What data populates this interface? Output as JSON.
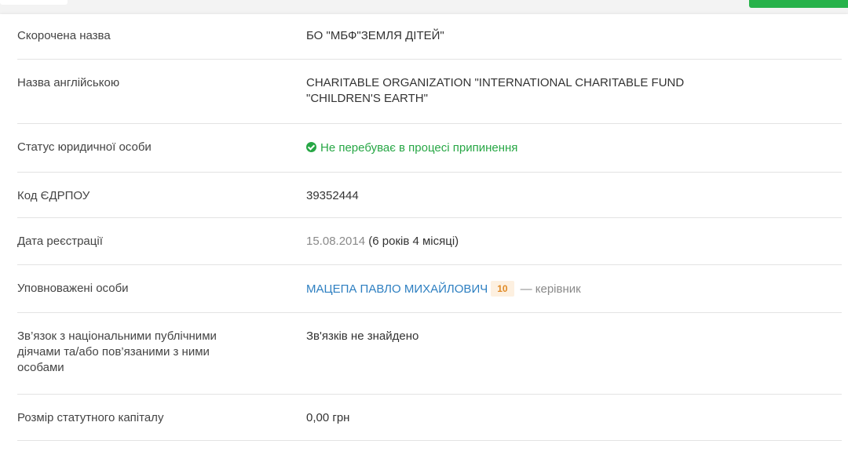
{
  "rows": [
    {
      "label": "Скорочена назва",
      "value": "БО \"МБФ\"ЗЕМЛЯ ДІТЕЙ\""
    },
    {
      "label": "Назва англійською",
      "value_line1": "CHARITABLE ORGANIZATION \"INTERNATIONAL CHARITABLE FUND",
      "value_line2": "\"CHILDREN'S EARTH\""
    },
    {
      "label": "Статус юридичної особи",
      "value": "Не перебуває в процесі припинення",
      "status_color": "#27a745"
    },
    {
      "label": "Код ЄДРПОУ",
      "value": "39352444"
    },
    {
      "label": "Дата реєстрації",
      "date": "15.08.2014",
      "duration": "(6 років 4 місяці)"
    },
    {
      "label": "Уповноважені особи",
      "person": "МАЦЕПА ПАВЛО МИХАЙЛОВИЧ",
      "badge": "10",
      "role": "— керівник"
    },
    {
      "label_line1": "Зв’язок з національними публічними",
      "label_line2": "діячами та/або пов’язаними з ними",
      "label_line3": "особами",
      "value": "Зв'язків не знайдено"
    },
    {
      "label": "Розмір статутного капіталу",
      "value": "0,00 грн"
    }
  ],
  "colors": {
    "accent_green": "#27b24a",
    "link_blue": "#2d7fc1",
    "badge_orange": "#e08a25"
  }
}
